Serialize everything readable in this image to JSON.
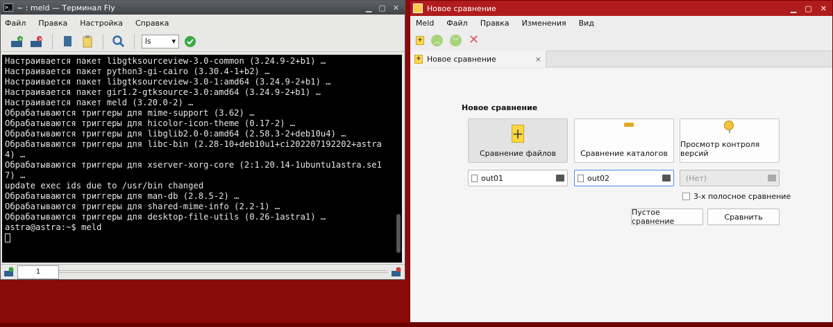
{
  "terminal": {
    "title": "~ : meld — Терминал Fly",
    "title_icon": ">_",
    "menu": [
      "Файл",
      "Правка",
      "Настройка",
      "Справка"
    ],
    "select_value": "ls",
    "lines": [
      "Настраивается пакет libgtksourceview-3.0-common (3.24.9-2+b1) …",
      "Настраивается пакет python3-gi-cairo (3.30.4-1+b2) …",
      "Настраивается пакет libgtksourceview-3.0-1:amd64 (3.24.9-2+b1) …",
      "Настраивается пакет gir1.2-gtksource-3.0:amd64 (3.24.9-2+b1) …",
      "Настраивается пакет meld (3.20.0-2) …",
      "Обрабатываются триггеры для mime-support (3.62) …",
      "Обрабатываются триггеры для hicolor-icon-theme (0.17-2) …",
      "Обрабатываются триггеры для libglib2.0-0:amd64 (2.58.3-2+deb10u4) …",
      "Обрабатываются триггеры для libc-bin (2.28-10+deb10u1+ci202207192202+astra",
      "4) …",
      "Обрабатываются триггеры для xserver-xorg-core (2:1.20.14-1ubuntu1astra.se1",
      "7) …",
      "update exec ids due to /usr/bin changed",
      "Обрабатываются триггеры для man-db (2.8.5-2) …",
      "Обрабатываются триггеры для shared-mime-info (2.2-1) …",
      "Обрабатываются триггеры для desktop-file-utils (0.26-1astra1) …",
      "astra@astra:~$ meld"
    ],
    "tab_label": "1"
  },
  "meld": {
    "title": "Новое сравнение",
    "menu": [
      "Meld",
      "Файл",
      "Правка",
      "Изменения",
      "Вид"
    ],
    "tab_label": "Новое сравнение",
    "tab_close": "×",
    "heading": "Новое сравнение",
    "buttons": {
      "file_compare": "Сравнение файлов",
      "dir_compare": "Сравнение каталогов",
      "vc_view": "Просмотр контроля версий"
    },
    "fields": {
      "file1": "out01",
      "file2": "out02",
      "file3_placeholder": "(Нет)"
    },
    "three_way_label": "3-х полосное сравнение",
    "empty_compare": "Пустое сравнение",
    "compare": "Сравнить"
  },
  "colors": {
    "desktop": "#8b0a0a",
    "meld_titlebar": "#b01c1c",
    "accent_focus": "#4b8fd8"
  }
}
